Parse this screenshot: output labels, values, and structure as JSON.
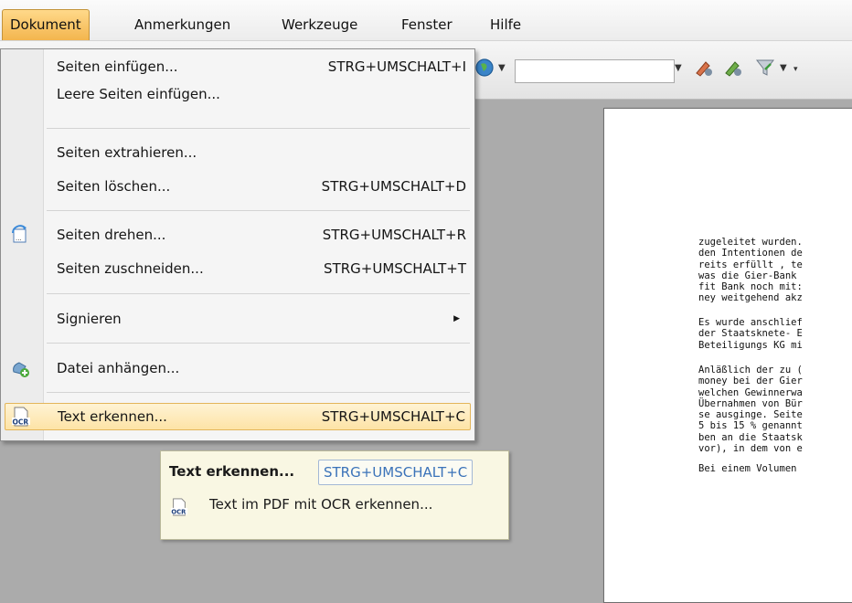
{
  "menubar": {
    "items": [
      "Dokument",
      "Anmerkungen",
      "Werkzeuge",
      "Fenster",
      "Hilfe"
    ],
    "active": "Dokument"
  },
  "toolbar": {
    "combo_value": "",
    "icons": [
      "globe-icon",
      "arrow-down-icon",
      "pen-tool-icon",
      "pen-tool-alt-icon",
      "funnel-icon",
      "overflow-icon"
    ]
  },
  "dokument_menu": {
    "items": [
      {
        "label": "Seiten einfügen...",
        "shortcut": "STRG+UMSCHALT+I"
      },
      {
        "label": "Leere Seiten einfügen...",
        "shortcut": ""
      },
      {
        "label": "Seiten extrahieren...",
        "shortcut": ""
      },
      {
        "label": "Seiten löschen...",
        "shortcut": "STRG+UMSCHALT+D"
      },
      {
        "label": "Seiten drehen...",
        "shortcut": "STRG+UMSCHALT+R",
        "icon": "rotate-pages-icon"
      },
      {
        "label": "Seiten zuschneiden...",
        "shortcut": "STRG+UMSCHALT+T"
      },
      {
        "label": "Signieren",
        "shortcut": "",
        "submenu": true
      },
      {
        "label": "Datei anhängen...",
        "shortcut": "",
        "icon": "attach-file-icon"
      },
      {
        "label": "Text erkennen...",
        "shortcut": "STRG+UMSCHALT+C",
        "icon": "ocr-icon",
        "highlighted": true
      }
    ]
  },
  "tooltip": {
    "title": "Text erkennen...",
    "shortcut": "STRG+UMSCHALT+C",
    "description": "Text im PDF mit OCR erkennen..."
  },
  "document": {
    "paragraphs": [
      [
        "zugeleitet wurden.",
        "den Intentionen de",
        "reits erfüllt , te",
        "was die Gier-Bank",
        "fit Bank noch mit:",
        "ney weitgehend akz"
      ],
      [
        "Es wurde anschlief",
        "der Staatsknete- E",
        "Beteiligungs KG mi"
      ],
      [
        "Anläßlich der zu (",
        "money bei der Gier",
        "welchen Gewinnerwa",
        "Übernahmen von Bür",
        "se ausginge. Seite",
        "5 bis 15 % genannt",
        "ben an die Staatsk",
        "vor), in dem von e"
      ],
      [
        "Bei einem Volumen"
      ]
    ]
  },
  "colors": {
    "menu_active": "#f3b54e",
    "highlight": "#fde3a6",
    "tooltip_bg": "#f9f7e3",
    "shortcut_blue": "#3b73b9",
    "workspace": "#ababab"
  }
}
